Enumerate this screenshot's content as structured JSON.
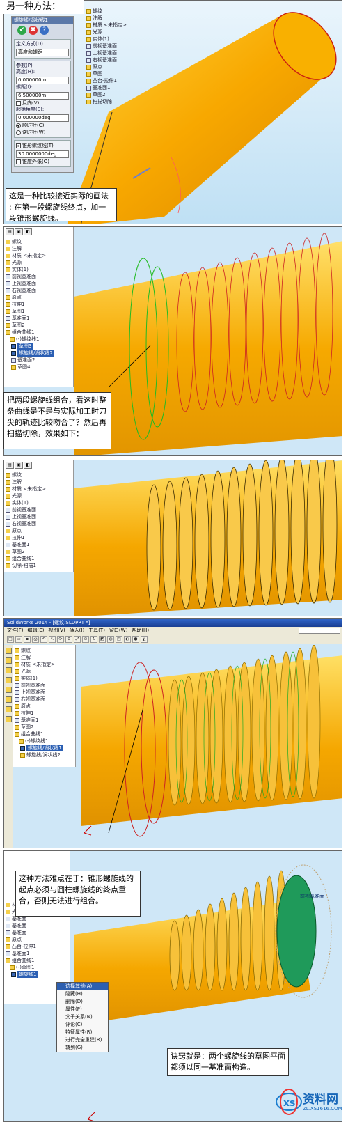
{
  "panel1": {
    "header_text": "另一种方法：",
    "pm_title": "螺旋线/涡状线1",
    "definition_section": "定义方式(D)",
    "definition_value": "高度和螺距",
    "params_section": "参数(P)",
    "height_label": "高度(H):",
    "height_value": "0.000000m",
    "pitch_label": "螺距(I):",
    "pitch_value": "6.500000m",
    "reverse_label": "反向(V)",
    "start_angle_label": "起始角度(S):",
    "start_angle_value": "0.000000deg",
    "cw_label": "顺时针(C)",
    "ccw_label": "逆时针(W)",
    "taper_section": "锥形螺纹线(T)",
    "taper_value": "30.0000000deg",
    "taper_out_label": "锥度外张(O)",
    "tree_items": [
      "螺纹",
      "注解",
      "材质 <未指定>",
      "光源",
      "实体(1)",
      "前视基准面",
      "上视基准面",
      "右视基准面",
      "原点",
      "草图1",
      "凸台-拉伸1",
      "基准面1",
      "草图2",
      "扫描切除"
    ],
    "callout": "这是一种比较接近实际的画法 : 在第一段螺旋线终点，加一段锥形螺旋线。"
  },
  "panel2": {
    "tree_items": [
      "螺纹",
      "注解",
      "材质 <未指定>",
      "光源",
      "实体(1)",
      "前视基准面",
      "上视基准面",
      "右视基准面",
      "原点",
      "拉伸1",
      "草图1",
      "基准面1",
      "草图2",
      "组合曲线1",
      "(-)螺纹线1",
      "草图3",
      "螺旋线/涡状线2",
      "基准面2",
      "草图4"
    ],
    "callout": "把两段螺旋线组合，看这时整条曲线是不是与实际加工时刀尖的轨迹比较吻合了？然后再扫描切除，效果如下："
  },
  "panel3": {
    "tree_items": [
      "螺纹",
      "注解",
      "材质 <未指定>",
      "光源",
      "实体(1)",
      "前视基准面",
      "上视基准面",
      "右视基准面",
      "原点",
      "拉伸1",
      "基准面1",
      "草图2",
      "组合曲线1",
      "切除-扫描1"
    ]
  },
  "panel4": {
    "title_bar": "SolidWorks 2014 - [螺纹.SLDPRT *]",
    "menu": [
      "文件(F)",
      "编辑(E)",
      "视图(V)",
      "插入(I)",
      "工具(T)",
      "窗口(W)",
      "帮助(H)"
    ],
    "search_placeholder": "搜索命令",
    "tree_items": [
      "螺纹",
      "注解",
      "材质 <未指定>",
      "光源",
      "实体(1)",
      "前视基准面",
      "上视基准面",
      "右视基准面",
      "原点",
      "拉伸1",
      "基准面1",
      "草图2",
      "组合曲线1",
      "(-)螺纹线1",
      "螺旋线/涡状线1",
      "螺旋线/涡状线2"
    ]
  },
  "panel5": {
    "callout_top": "这种方法难点在于：锥形螺旋线的起点必须与圆柱螺旋线的终点重合，否则无法进行组合。",
    "callout_bottom": "诀窍就是：两个螺旋线的草图平面都须以同一基准面构造。",
    "plane_label": "前视基准面",
    "context_menu": [
      "选择其他(A)",
      "隐藏(H)",
      "删除(D)",
      "属性(P)",
      "父子关系(N)",
      "评论(C)",
      "特征属性(R)",
      "进行完全重建(R)",
      "转到(G)"
    ],
    "tree_items": [
      "材质",
      "光源",
      "基准面",
      "基准面",
      "基准面",
      "原点",
      "凸台-拉伸1",
      "基准面1",
      "组合曲线1",
      "(-)草图1",
      "螺旋线1"
    ]
  },
  "watermark": {
    "logo_text": "资料网",
    "url_text": "ZL.XS1616.COM"
  }
}
